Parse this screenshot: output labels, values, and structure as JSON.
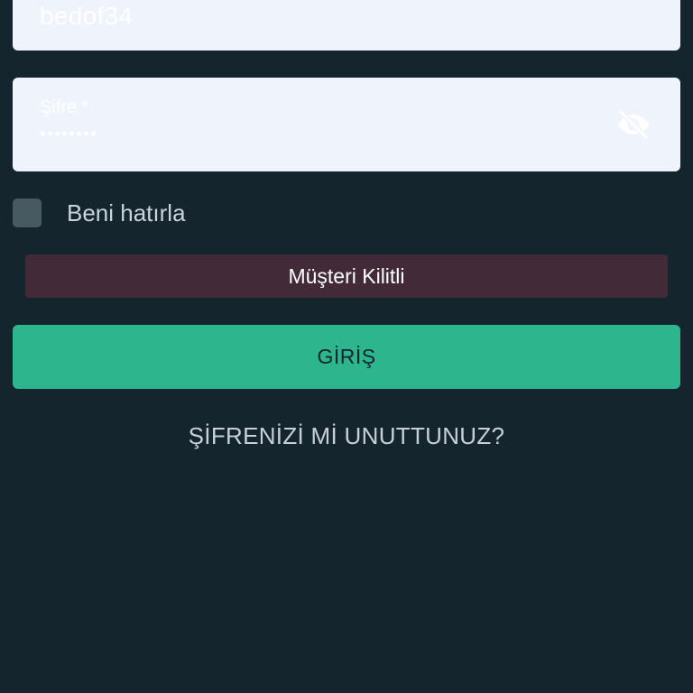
{
  "login_form": {
    "username_value": "bedof34",
    "password_label": "Şifre *",
    "password_value": "••••••••",
    "password_toggle_icon": "eye-off-icon",
    "remember_me_label": "Beni hatırla",
    "remember_me_checked": false,
    "alert_message": "Müşteri Kilitli",
    "login_button_label": "GİRİŞ",
    "forgot_password_link": "ŞİFRENİZİ Mİ UNUTTUNUZ?"
  },
  "colors": {
    "background": "#15252d",
    "input_background": "#eef3fc",
    "alert_background": "#432a38",
    "primary_button": "#2db58d"
  }
}
